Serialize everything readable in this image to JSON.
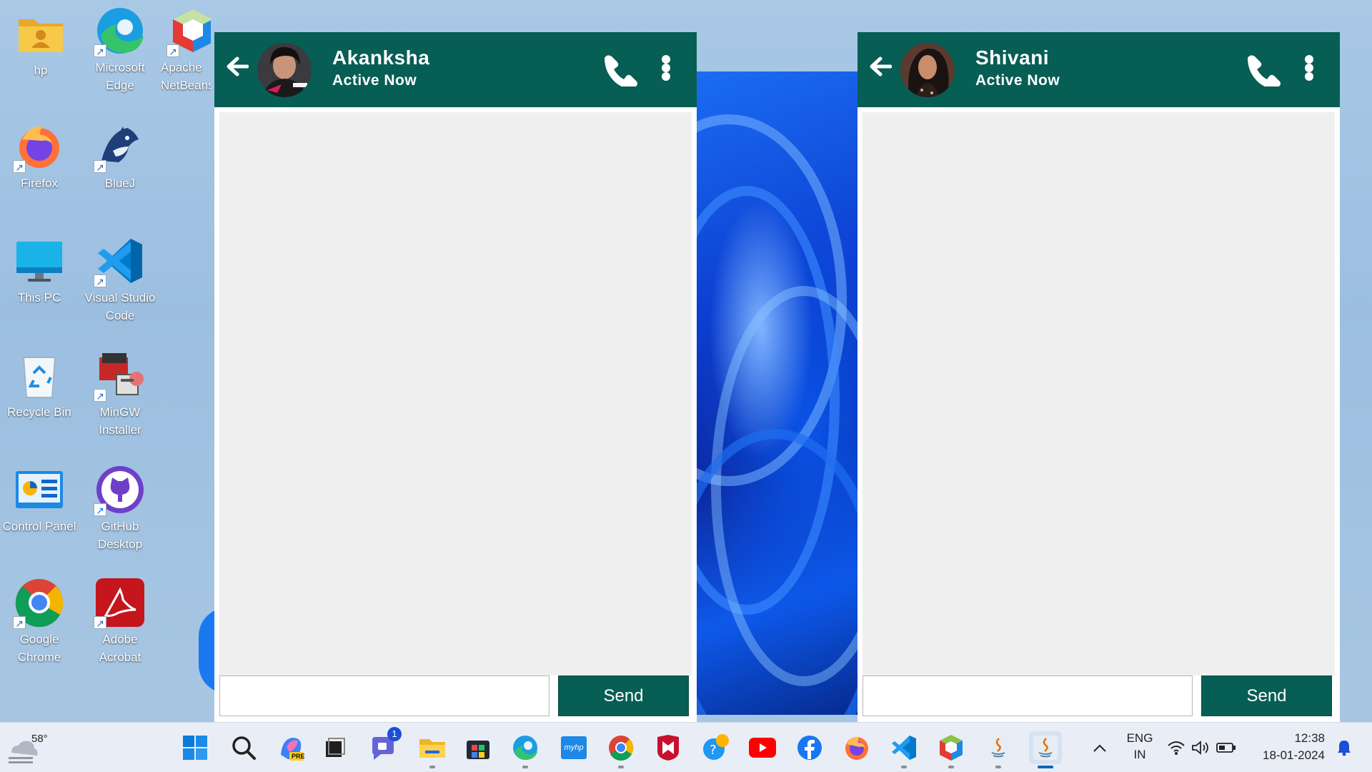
{
  "desktop": {
    "icons": [
      {
        "label": "hp",
        "icon": "folder-user-icon"
      },
      {
        "label": "Microsoft Edge",
        "icon": "edge-icon"
      },
      {
        "label": "Apache NetBeans",
        "icon": "netbeans-icon"
      },
      {
        "label": "Firefox",
        "icon": "firefox-icon"
      },
      {
        "label": "BlueJ",
        "icon": "bluej-icon"
      },
      {
        "label": "This PC",
        "icon": "monitor-icon"
      },
      {
        "label": "Visual Studio Code",
        "icon": "vscode-icon"
      },
      {
        "label": "Recycle Bin",
        "icon": "recycle-bin-icon"
      },
      {
        "label": "MinGW Installer",
        "icon": "mingw-icon"
      },
      {
        "label": "Control Panel",
        "icon": "control-panel-icon"
      },
      {
        "label": "GitHub Desktop",
        "icon": "github-icon"
      },
      {
        "label": "Google Chrome",
        "icon": "chrome-icon"
      },
      {
        "label": "Adobe Acrobat",
        "icon": "acrobat-icon"
      }
    ]
  },
  "chats": [
    {
      "name": "Akanksha",
      "status": "Active Now",
      "input_value": "",
      "send_label": "Send",
      "header_color": "#075e54"
    },
    {
      "name": "Shivani",
      "status": "Active Now",
      "input_value": "",
      "send_label": "Send",
      "header_color": "#075e54"
    }
  ],
  "taskbar": {
    "weather_temp": "58°",
    "teams_badge": "1",
    "language": "ENG",
    "region": "IN",
    "time": "12:38",
    "date": "18-01-2024",
    "apps": [
      "windows-start-icon",
      "search-icon",
      "copilot-pre-icon",
      "task-view-icon",
      "teams-chat-icon",
      "file-explorer-icon",
      "microsoft-store-icon",
      "edge-icon",
      "myhp-icon",
      "chrome-icon",
      "mcafee-icon",
      "get-help-icon",
      "youtube-icon",
      "facebook-icon",
      "firefox-icon",
      "vscode-icon",
      "netbeans-icon",
      "java-icon",
      "java-active-icon"
    ],
    "myhp_label": "myhp",
    "copilot_badge": "PRE"
  }
}
